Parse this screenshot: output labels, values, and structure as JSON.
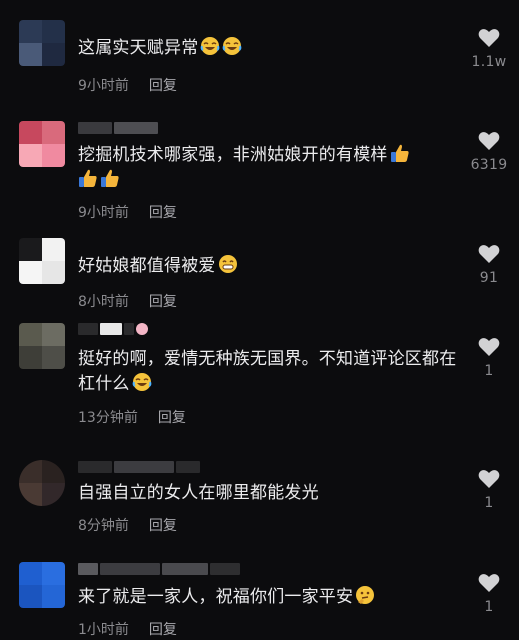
{
  "comments": [
    {
      "text": "这属实天赋异常",
      "emojis": [
        "laugh-cry-icon",
        "laugh-cry-icon"
      ],
      "time": "9小时前",
      "reply": "回复",
      "likes": "1.1w"
    },
    {
      "text": "挖掘机技术哪家强，非洲姑娘开的有模样",
      "emojis": [
        "thumbs-up-icon",
        "thumbs-up-icon",
        "thumbs-up-icon"
      ],
      "time": "9小时前",
      "reply": "回复",
      "likes": "6319"
    },
    {
      "text": "好姑娘都值得被爱",
      "emojis": [
        "grin-icon"
      ],
      "time": "8小时前",
      "reply": "回复",
      "likes": "91"
    },
    {
      "text": "挺好的啊，爱情无种族无国界。不知道评论区都在杠什么",
      "emojis": [
        "laugh-cry-icon"
      ],
      "time": "13分钟前",
      "reply": "回复",
      "likes": "1"
    },
    {
      "text": "自强自立的女人在哪里都能发光",
      "emojis": [],
      "time": "8分钟前",
      "reply": "回复",
      "likes": "1"
    },
    {
      "text": "来了就是一家人，祝福你们一家平安",
      "emojis": [
        "thinking-icon"
      ],
      "time": "1小时前",
      "reply": "回复",
      "likes": "1"
    }
  ],
  "colors": {
    "background": "#0c0c0e",
    "text": "#ececee",
    "meta": "#8a8a8e",
    "heart": "#d2d2d4"
  }
}
